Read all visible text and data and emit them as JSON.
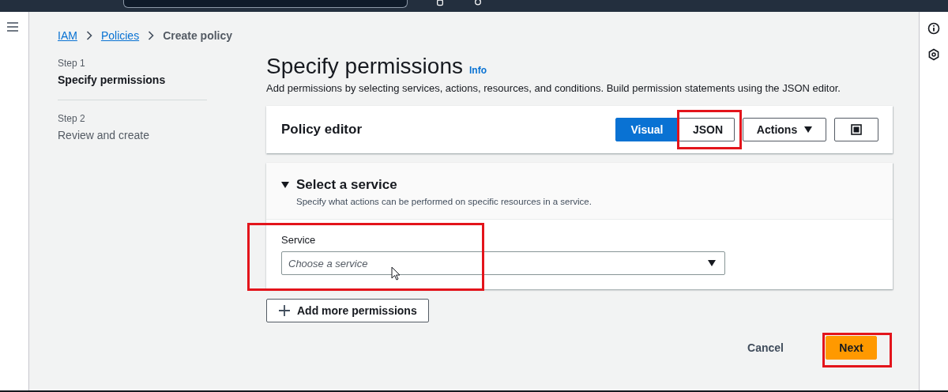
{
  "breadcrumb": [
    {
      "label": "IAM",
      "link": true
    },
    {
      "label": "Policies",
      "link": true
    },
    {
      "label": "Create policy",
      "link": false
    }
  ],
  "steps": [
    {
      "step": "Step 1",
      "label": "Specify permissions",
      "selected": true
    },
    {
      "step": "Step 2",
      "label": "Review and create",
      "selected": false
    }
  ],
  "page": {
    "title": "Specify permissions",
    "info": "Info",
    "description": "Add permissions by selecting services, actions, resources, and conditions. Build permission statements using the JSON editor."
  },
  "policy_editor": {
    "title": "Policy editor",
    "modes": [
      {
        "label": "Visual",
        "selected": true,
        "highlighted": false
      },
      {
        "label": "JSON",
        "selected": false,
        "highlighted": true
      }
    ],
    "actions": "Actions"
  },
  "service_section": {
    "title": "Select a service",
    "expanded": true,
    "description": "Specify what actions can be performed on specific resources in a service.",
    "field_label": "Service",
    "placeholder": "Choose a service",
    "highlighted": true
  },
  "add_button": "Add more permissions",
  "footer": [
    {
      "label": "Cancel",
      "kind": "link"
    },
    {
      "label": "Next",
      "kind": "primary",
      "highlighted": true
    }
  ]
}
